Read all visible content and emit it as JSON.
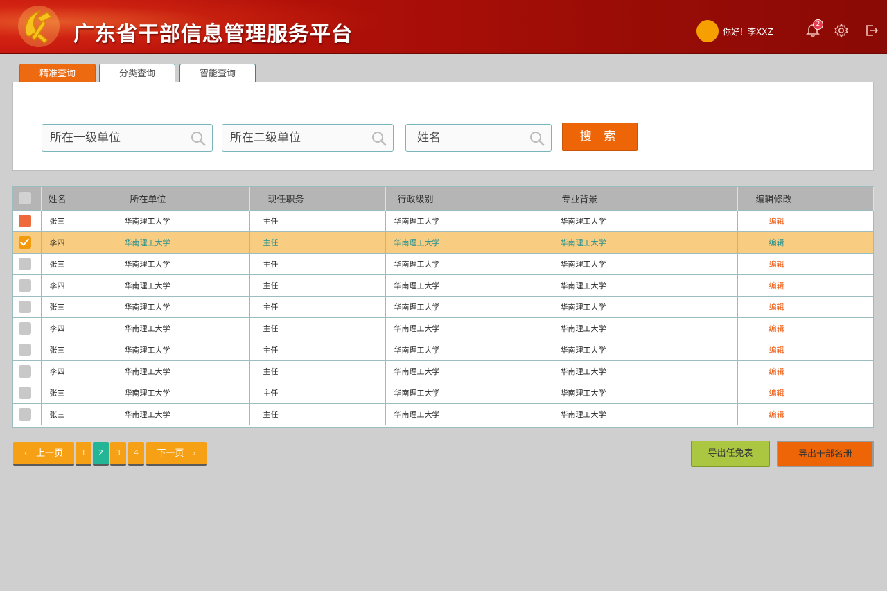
{
  "header": {
    "app_title": "广东省干部信息管理服务平台",
    "greeting": "你好！李XXZ",
    "notification_count": "2"
  },
  "tabs": [
    {
      "label": "精准查询",
      "active": true
    },
    {
      "label": "分类查询",
      "active": false
    },
    {
      "label": "智能查询",
      "active": false
    }
  ],
  "search": {
    "unit1_placeholder": "所在一级单位",
    "unit2_placeholder": "所在二级单位",
    "name_placeholder": "姓名",
    "button_label": "搜 索"
  },
  "table": {
    "columns": [
      "姓名",
      "所在单位",
      "现任职务",
      "行政级别",
      "专业背景",
      "编辑修改"
    ],
    "rows": [
      {
        "name": "张三",
        "unit": "华南理工大学",
        "position": "主任",
        "level": "华南理工大学",
        "background": "华南理工大学",
        "edit": "编辑",
        "checkbox": "red"
      },
      {
        "name": "李四",
        "unit": "华南理工大学",
        "position": "主任",
        "level": "华南理工大学",
        "background": "华南理工大学",
        "edit": "编辑",
        "checkbox": "checked"
      },
      {
        "name": "张三",
        "unit": "华南理工大学",
        "position": "主任",
        "level": "华南理工大学",
        "background": "华南理工大学",
        "edit": "编辑",
        "checkbox": "unchecked"
      },
      {
        "name": "李四",
        "unit": "华南理工大学",
        "position": "主任",
        "level": "华南理工大学",
        "background": "华南理工大学",
        "edit": "编辑",
        "checkbox": "unchecked"
      },
      {
        "name": "张三",
        "unit": "华南理工大学",
        "position": "主任",
        "level": "华南理工大学",
        "background": "华南理工大学",
        "edit": "编辑",
        "checkbox": "unchecked"
      },
      {
        "name": "李四",
        "unit": "华南理工大学",
        "position": "主任",
        "level": "华南理工大学",
        "background": "华南理工大学",
        "edit": "编辑",
        "checkbox": "unchecked"
      },
      {
        "name": "张三",
        "unit": "华南理工大学",
        "position": "主任",
        "level": "华南理工大学",
        "background": "华南理工大学",
        "edit": "编辑",
        "checkbox": "unchecked"
      },
      {
        "name": "李四",
        "unit": "华南理工大学",
        "position": "主任",
        "level": "华南理工大学",
        "background": "华南理工大学",
        "edit": "编辑",
        "checkbox": "unchecked"
      },
      {
        "name": "张三",
        "unit": "华南理工大学",
        "position": "主任",
        "level": "华南理工大学",
        "background": "华南理工大学",
        "edit": "编辑",
        "checkbox": "unchecked"
      },
      {
        "name": "张三",
        "unit": "华南理工大学",
        "position": "主任",
        "level": "华南理工大学",
        "background": "华南理工大学",
        "edit": "编辑",
        "checkbox": "unchecked"
      }
    ]
  },
  "pagination": {
    "prev_label": "上一页",
    "next_label": "下一页",
    "pages": [
      "1",
      "2",
      "3",
      "4"
    ],
    "current_page": "2"
  },
  "actions": {
    "export_dismissal_label": "导出任免表",
    "export_roster_label": "导出干部名册"
  },
  "colors": {
    "header_red": "#b01008",
    "accent_orange": "#ee6508",
    "selected_row": "#f8cd82",
    "teal": "#1f8f8f",
    "export_green": "#abc741"
  }
}
